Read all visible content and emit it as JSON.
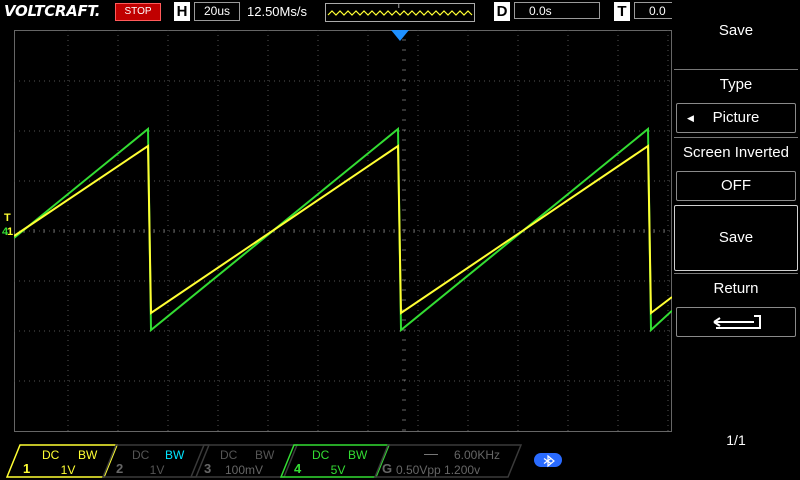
{
  "brand": "VOLTCRAFT.",
  "status": "STOP",
  "horizontal": {
    "letter": "H",
    "timebase": "20us",
    "sample_rate": "12.50Ms/s",
    "trigger_pos_marker": "T"
  },
  "delay": {
    "letter": "D",
    "value": "0.0s"
  },
  "trigger": {
    "letter": "T",
    "value": "0.0"
  },
  "screen_markers": {
    "trigger_level": "T",
    "ch1_ground": "1",
    "ch4_ground": "4"
  },
  "waveforms": {
    "period_us": 100,
    "timebase_us_per_div": 20,
    "channels": [
      {
        "name": "CH1",
        "color": "#ffff33"
      },
      {
        "name": "CH4",
        "color": "#33dd33"
      }
    ]
  },
  "menu": {
    "title": "Save",
    "type_label": "Type",
    "type_value": "Picture",
    "screen_inverted_label": "Screen Inverted",
    "screen_inverted_value": "OFF",
    "save_label": "Save",
    "return_label": "Return",
    "page": "1/1"
  },
  "channels": [
    {
      "num": "1",
      "coupling": "DC",
      "bw": "BW",
      "scale": "1V",
      "active": true,
      "color": "#ffff33"
    },
    {
      "num": "2",
      "coupling": "DC",
      "bw": "BW",
      "scale": "1V",
      "active": false,
      "color": "#00e5ff"
    },
    {
      "num": "3",
      "coupling": "DC",
      "bw": "BW",
      "scale": "100mV",
      "active": false,
      "color": "#ff40ff"
    },
    {
      "num": "4",
      "coupling": "DC",
      "bw": "BW",
      "scale": "5V",
      "active": true,
      "color": "#33dd33"
    }
  ],
  "generator": {
    "letter": "G",
    "freq": "6.00KHz",
    "params": "0.50Vpp  1.200v",
    "wave_icon": "dash"
  },
  "bluetooth_icon": "bluetooth-icon",
  "colors": {
    "status_stop": "#c00000",
    "ch1": "#ffff33",
    "ch4": "#33dd33",
    "bluetooth": "#2a6bff",
    "trigger_marker": "#1e90ff"
  }
}
